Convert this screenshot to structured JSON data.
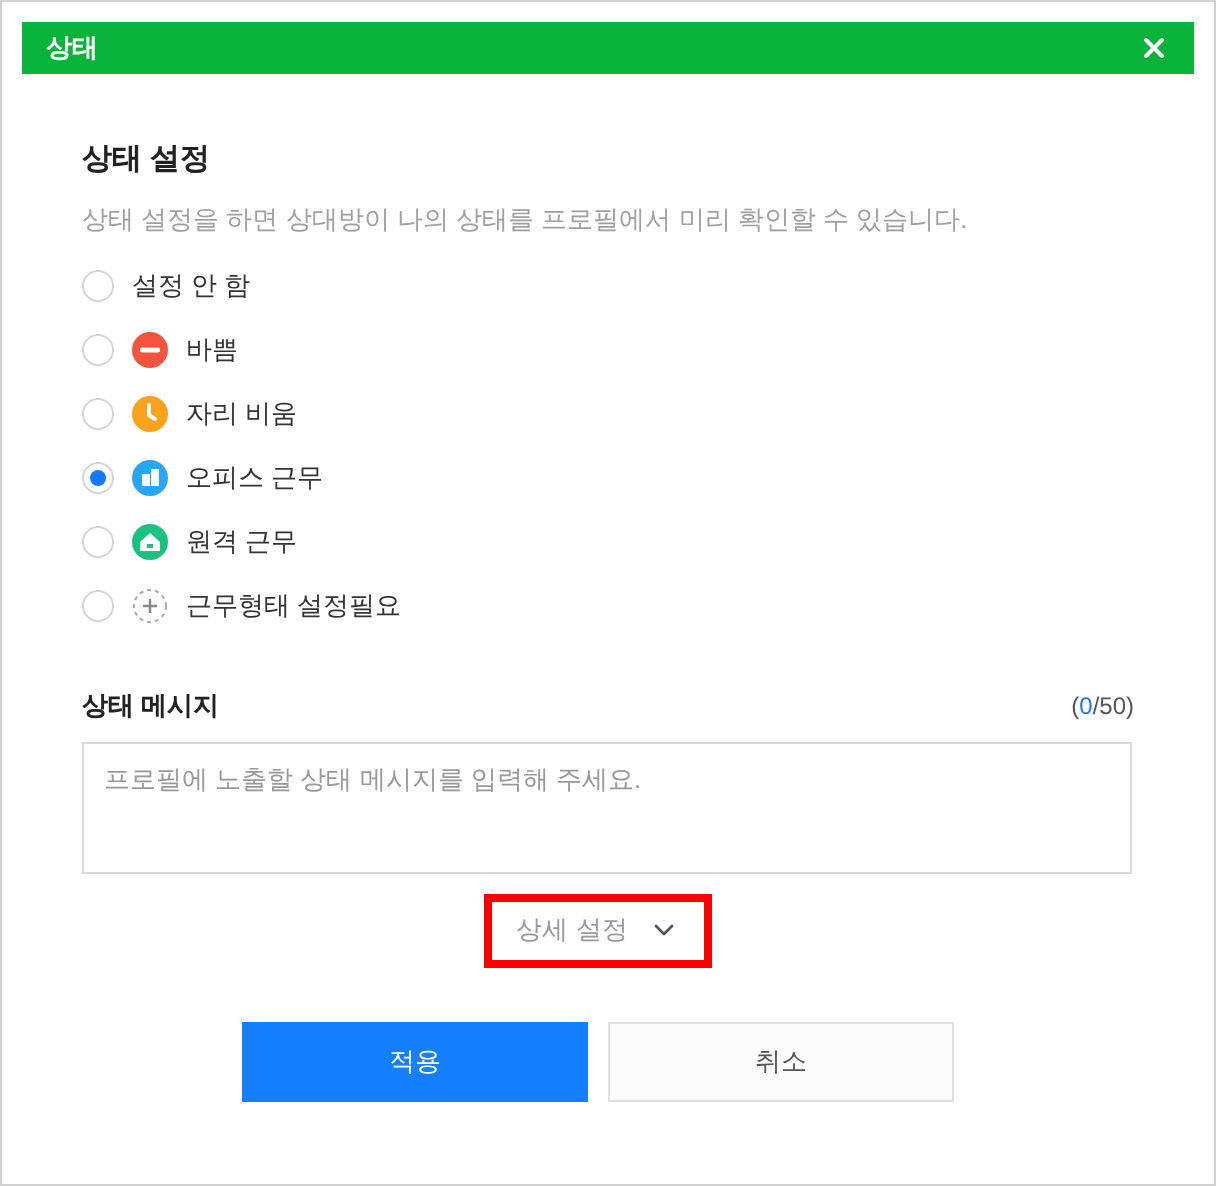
{
  "window": {
    "title": "상태"
  },
  "status": {
    "heading": "상태 설정",
    "description": "상태 설정을 하면 상대방이 나의 상태를 프로필에서 미리 확인할 수 있습니다.",
    "options": [
      {
        "kind": "none",
        "label": "설정 안 함",
        "selected": false
      },
      {
        "kind": "busy",
        "label": "바쁨",
        "selected": false
      },
      {
        "kind": "away",
        "label": "자리 비움",
        "selected": false
      },
      {
        "kind": "office",
        "label": "오피스 근무",
        "selected": true
      },
      {
        "kind": "remote",
        "label": "원격 근무",
        "selected": false
      },
      {
        "kind": "unset",
        "label": "근무형태 설정필요",
        "selected": false
      }
    ]
  },
  "message": {
    "heading": "상태 메시지",
    "counter": {
      "open": "(",
      "count": "0",
      "rest": "/50)"
    },
    "placeholder": "프로필에 노출할 상태 메시지를 입력해 주세요."
  },
  "details_button": {
    "label": "상세 설정",
    "highlighted": true
  },
  "buttons": [
    {
      "kind": "primary",
      "label": "적용"
    },
    {
      "kind": "secondary",
      "label": "취소"
    }
  ]
}
